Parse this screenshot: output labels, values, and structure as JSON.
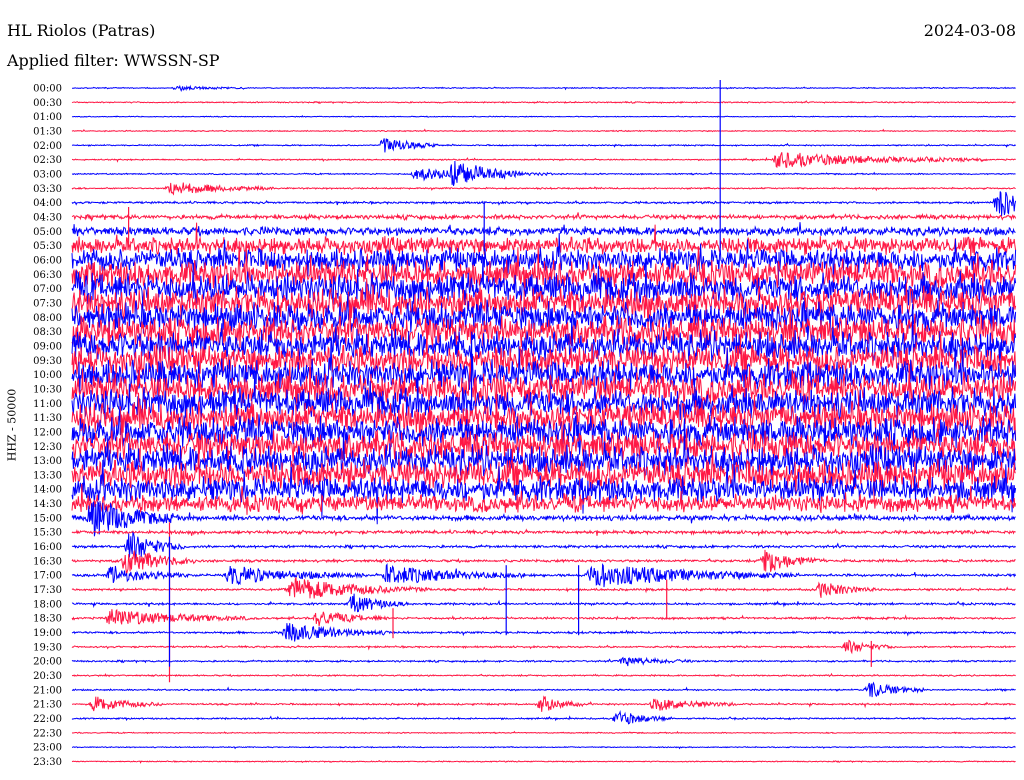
{
  "header": {
    "station": "HL Riolos (Patras)",
    "date": "2024-03-08",
    "filter": "Applied filter: WWSSN-SP"
  },
  "colors": {
    "blue": "#0000ff",
    "red": "#ff1744",
    "background": "#ffffff",
    "text": "#000000"
  },
  "chart_data": {
    "type": "line",
    "ylabel": "HHZ - 50000",
    "series_colors": [
      "#0000ff",
      "#ff1744"
    ],
    "rows": [
      {
        "time": "00:00",
        "noise": 0.5
      },
      {
        "time": "00:30",
        "noise": 0.6
      },
      {
        "time": "01:00",
        "noise": 0.4
      },
      {
        "time": "01:30",
        "noise": 0.5
      },
      {
        "time": "02:00",
        "noise": 0.6
      },
      {
        "time": "02:30",
        "noise": 0.6
      },
      {
        "time": "03:00",
        "noise": 0.6
      },
      {
        "time": "03:30",
        "noise": 0.7
      },
      {
        "time": "04:00",
        "noise": 1.0
      },
      {
        "time": "04:30",
        "noise": 2.0
      },
      {
        "time": "05:00",
        "noise": 4.0
      },
      {
        "time": "05:30",
        "noise": 8.0
      },
      {
        "time": "06:00",
        "noise": 11.0
      },
      {
        "time": "06:30",
        "noise": 13.0
      },
      {
        "time": "07:00",
        "noise": 14.0
      },
      {
        "time": "07:30",
        "noise": 14.0
      },
      {
        "time": "08:00",
        "noise": 14.0
      },
      {
        "time": "08:30",
        "noise": 14.0
      },
      {
        "time": "09:00",
        "noise": 14.0
      },
      {
        "time": "09:30",
        "noise": 14.0
      },
      {
        "time": "10:00",
        "noise": 14.0
      },
      {
        "time": "10:30",
        "noise": 14.0
      },
      {
        "time": "11:00",
        "noise": 14.0
      },
      {
        "time": "11:30",
        "noise": 14.0
      },
      {
        "time": "12:00",
        "noise": 14.0
      },
      {
        "time": "12:30",
        "noise": 14.0
      },
      {
        "time": "13:00",
        "noise": 14.0
      },
      {
        "time": "13:30",
        "noise": 14.0
      },
      {
        "time": "14:00",
        "noise": 12.0
      },
      {
        "time": "14:30",
        "noise": 8.0
      },
      {
        "time": "15:00",
        "noise": 2.5
      },
      {
        "time": "15:30",
        "noise": 1.5
      },
      {
        "time": "16:00",
        "noise": 1.2
      },
      {
        "time": "16:30",
        "noise": 1.2
      },
      {
        "time": "17:00",
        "noise": 1.2
      },
      {
        "time": "17:30",
        "noise": 1.0
      },
      {
        "time": "18:00",
        "noise": 1.0
      },
      {
        "time": "18:30",
        "noise": 1.0
      },
      {
        "time": "19:00",
        "noise": 1.0
      },
      {
        "time": "19:30",
        "noise": 0.8
      },
      {
        "time": "20:00",
        "noise": 0.8
      },
      {
        "time": "20:30",
        "noise": 0.7
      },
      {
        "time": "21:00",
        "noise": 0.7
      },
      {
        "time": "21:30",
        "noise": 0.8
      },
      {
        "time": "22:00",
        "noise": 0.7
      },
      {
        "time": "22:30",
        "noise": 0.5
      },
      {
        "time": "23:00",
        "noise": 0.5
      },
      {
        "time": "23:30",
        "noise": 0.5
      }
    ],
    "events": [
      {
        "time": "00:00",
        "minute": 3.3,
        "amp": 2,
        "dur": 1.0
      },
      {
        "time": "02:00",
        "minute": 9.9,
        "amp": 9,
        "dur": 0.8
      },
      {
        "time": "02:30",
        "minute": 22.4,
        "amp": 8,
        "dur": 3.0
      },
      {
        "time": "03:00",
        "minute": 10.9,
        "amp": 6,
        "dur": 2.0
      },
      {
        "time": "03:00",
        "minute": 12.1,
        "amp": 12,
        "dur": 1.0
      },
      {
        "time": "03:30",
        "minute": 3.1,
        "amp": 7,
        "dur": 1.5
      },
      {
        "time": "04:00",
        "minute": 29.4,
        "amp": 14,
        "dur": 1.5
      },
      {
        "time": "15:00",
        "minute": 0.6,
        "amp": 20,
        "dur": 1.2
      },
      {
        "time": "16:00",
        "minute": 1.8,
        "amp": 16,
        "dur": 0.8
      },
      {
        "time": "16:30",
        "minute": 1.7,
        "amp": 14,
        "dur": 1.0
      },
      {
        "time": "16:30",
        "minute": 22.0,
        "amp": 14,
        "dur": 0.8
      },
      {
        "time": "17:00",
        "minute": 1.2,
        "amp": 8,
        "dur": 1.2
      },
      {
        "time": "17:00",
        "minute": 5.0,
        "amp": 9,
        "dur": 2.0
      },
      {
        "time": "17:00",
        "minute": 10.0,
        "amp": 10,
        "dur": 2.0
      },
      {
        "time": "17:00",
        "minute": 16.5,
        "amp": 12,
        "dur": 3.0
      },
      {
        "time": "17:30",
        "minute": 7.0,
        "amp": 12,
        "dur": 2.0
      },
      {
        "time": "17:30",
        "minute": 23.8,
        "amp": 8,
        "dur": 0.8
      },
      {
        "time": "18:00",
        "minute": 8.9,
        "amp": 10,
        "dur": 0.8
      },
      {
        "time": "18:30",
        "minute": 1.2,
        "amp": 9,
        "dur": 2.0
      },
      {
        "time": "18:30",
        "minute": 7.8,
        "amp": 8,
        "dur": 1.0
      },
      {
        "time": "19:00",
        "minute": 6.8,
        "amp": 10,
        "dur": 1.5
      },
      {
        "time": "19:30",
        "minute": 24.6,
        "amp": 7,
        "dur": 0.7
      },
      {
        "time": "20:00",
        "minute": 17.5,
        "amp": 5,
        "dur": 1.0
      },
      {
        "time": "21:00",
        "minute": 25.3,
        "amp": 9,
        "dur": 0.8
      },
      {
        "time": "21:30",
        "minute": 0.7,
        "amp": 8,
        "dur": 1.0
      },
      {
        "time": "21:30",
        "minute": 14.9,
        "amp": 9,
        "dur": 0.6
      },
      {
        "time": "21:30",
        "minute": 18.5,
        "amp": 7,
        "dur": 1.2
      },
      {
        "time": "22:00",
        "minute": 17.3,
        "amp": 8,
        "dur": 0.8
      }
    ],
    "spikes": [
      {
        "time": "00:00",
        "minute": 20.6,
        "up": 8,
        "down": 160
      },
      {
        "time": "04:30",
        "minute": 1.8,
        "up": 10,
        "down": 30
      },
      {
        "time": "05:00",
        "minute": 13.1,
        "up": 30,
        "down": 20
      },
      {
        "time": "15:30",
        "minute": 3.1,
        "up": 10,
        "down": 150
      },
      {
        "time": "16:00",
        "minute": 3.1,
        "up": 10,
        "down": 120
      },
      {
        "time": "09:00",
        "minute": 12.7,
        "up": 10,
        "down": 60
      },
      {
        "time": "09:30",
        "minute": 13.5,
        "up": 10,
        "down": 70
      },
      {
        "time": "17:00",
        "minute": 13.8,
        "up": 10,
        "down": 60
      },
      {
        "time": "17:30",
        "minute": 18.9,
        "up": 10,
        "down": 30
      },
      {
        "time": "18:30",
        "minute": 10.2,
        "up": 10,
        "down": 20
      },
      {
        "time": "17:00",
        "minute": 16.1,
        "up": 10,
        "down": 60
      },
      {
        "time": "19:30",
        "minute": 25.4,
        "up": 6,
        "down": 20
      },
      {
        "time": "20:00",
        "minute": 33.5,
        "up": 30,
        "down": 15
      }
    ]
  }
}
